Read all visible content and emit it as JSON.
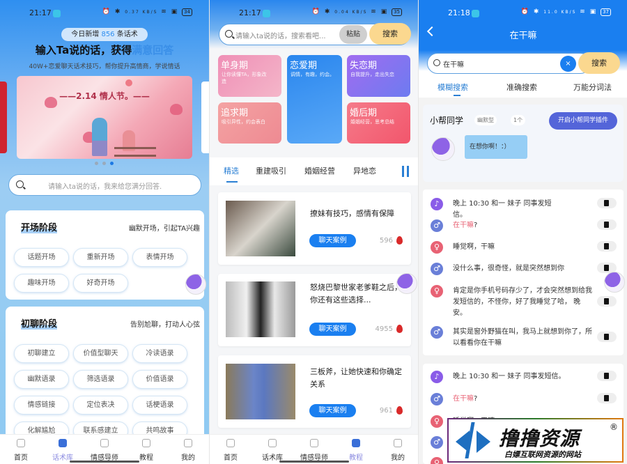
{
  "panel1": {
    "status": {
      "time": "21:17",
      "speed": "0.37 KB/S",
      "battery": "34"
    },
    "new_badge": {
      "prefix": "今日新增",
      "count": "856",
      "suffix": "条话术"
    },
    "headline": {
      "main": "输入Ta说的话，获得",
      "highlight": "满意回答"
    },
    "subline": "40W+恋爱聊天话术技巧，帮你提升高情商，学说情话",
    "banner": {
      "title": "——2.14 情人节。——",
      "active_dot": 3,
      "dot_count": 3
    },
    "search": {
      "placeholder": "请输入ta说的话，我来给您满分回答."
    },
    "sections": [
      {
        "title": "开场阶段",
        "desc": "幽默开场，引起TA兴趣",
        "chips": [
          "话题开场",
          "重新开场",
          "表情开场",
          "趣味开场",
          "好奇开场"
        ]
      },
      {
        "title": "初聊阶段",
        "desc": "告别尬聊，打动人心弦",
        "chips": [
          "初聊建立",
          "价值型聊天",
          "冷读语录",
          "幽默语录",
          "筛选语录",
          "价值语录",
          "情感链接",
          "定位表决",
          "话梗语录",
          "化解尴尬",
          "联系感建立",
          "共鸣故事"
        ]
      }
    ],
    "nav": [
      {
        "label": "首页",
        "icon": "home-cube-icon",
        "active": false
      },
      {
        "label": "话术库",
        "icon": "library-cube-icon",
        "active": true
      },
      {
        "label": "情感导师",
        "icon": "mentor-cube-icon",
        "active": false
      },
      {
        "label": "教程",
        "icon": "tutorial-cube-icon",
        "active": false
      },
      {
        "label": "我的",
        "icon": "profile-cube-icon",
        "active": false
      }
    ]
  },
  "panel2": {
    "status": {
      "time": "21:17",
      "speed": "0.04 KB/S",
      "battery": "35"
    },
    "search": {
      "placeholder": "请输入ta说的话，搜索看吧...",
      "paste_label": "粘贴",
      "search_label": "搜索"
    },
    "stages": [
      {
        "title": "单身期",
        "desc": "让你读懂TA，形象改造",
        "color": "#ee8fb5"
      },
      {
        "title": "恋爱期",
        "desc": "调情，有趣，约会。",
        "color": "#2a86ee"
      },
      {
        "title": "失恋期",
        "desc": "自我提升，走出失恋",
        "color": "#8b74ef"
      },
      {
        "title": "追求期",
        "desc": "吸引异性，约会表白",
        "color": "#f09a9a"
      },
      {
        "title": "婚后期",
        "desc": "婚姻经营，思考总结",
        "color": "#f26a7c"
      }
    ],
    "tabs": [
      {
        "label": "精选",
        "active": true
      },
      {
        "label": "重建吸引",
        "active": false
      },
      {
        "label": "婚姻经营",
        "active": false
      },
      {
        "label": "异地恋",
        "active": false
      }
    ],
    "articles": [
      {
        "title": "撩妹有技巧，感情有保障",
        "button": "聊天案例",
        "count": "596"
      },
      {
        "title": "怒烧巴黎世家老爹鞋之后，你还有这些选择...",
        "button": "聊天案例",
        "count": "4955"
      },
      {
        "title": "三板斧，让她快速和你确定关系",
        "button": "聊天案例",
        "count": "961"
      }
    ],
    "nav": [
      {
        "label": "首页",
        "active": false
      },
      {
        "label": "话术库",
        "active": false
      },
      {
        "label": "情感导师",
        "active": false
      },
      {
        "label": "教程",
        "active": true
      },
      {
        "label": "我的",
        "active": false
      }
    ]
  },
  "panel3": {
    "status": {
      "time": "21:18",
      "speed": "11.0 KB/S",
      "battery": "37"
    },
    "title": "在干嘛",
    "search": {
      "value": "在干嘛",
      "clear_label": "×",
      "search_label": "搜索"
    },
    "tabs": [
      {
        "label": "模糊搜索",
        "active": true
      },
      {
        "label": "准确搜索",
        "active": false
      },
      {
        "label": "万能分词法",
        "active": false
      }
    ],
    "helper": {
      "name": "小帮同学",
      "style": "幽默型",
      "count": "1个",
      "plugin_button": "开启小帮同学插件",
      "bubble": "在想你啊！：）"
    },
    "dialog1": [
      {
        "role": "bell",
        "text": "晚上 10:30 和一 妹子 同事发短信。"
      },
      {
        "role": "male",
        "keyword": "在干嘛",
        "text": "?"
      },
      {
        "role": "female",
        "text": "睡觉啊，干嘛"
      },
      {
        "role": "male",
        "text": "没什么事，很奇怪，就是突然想到你"
      },
      {
        "role": "female",
        "text": "肯定是你手机号码存少了，才会突然想到给我发短信的，不怪你，好了我睡觉了哈， 晚安。"
      },
      {
        "role": "male",
        "text": "其实是窗外野猫在叫，我马上就想到你了，所以看看你在干嘛"
      }
    ],
    "dialog2": [
      {
        "role": "bell",
        "text": "晚上 10:30 和一 妹子 同事发短信。"
      },
      {
        "role": "male",
        "keyword": "在干嘛",
        "text": "?"
      },
      {
        "role": "female",
        "text": "睡觉啊，干嘛"
      },
      {
        "role": "male",
        "text": ""
      },
      {
        "role": "female",
        "text": ""
      }
    ]
  },
  "watermark": {
    "title": "撸撸资源",
    "reg": "®",
    "subtitle": "白嫖互联网资源的网站"
  }
}
